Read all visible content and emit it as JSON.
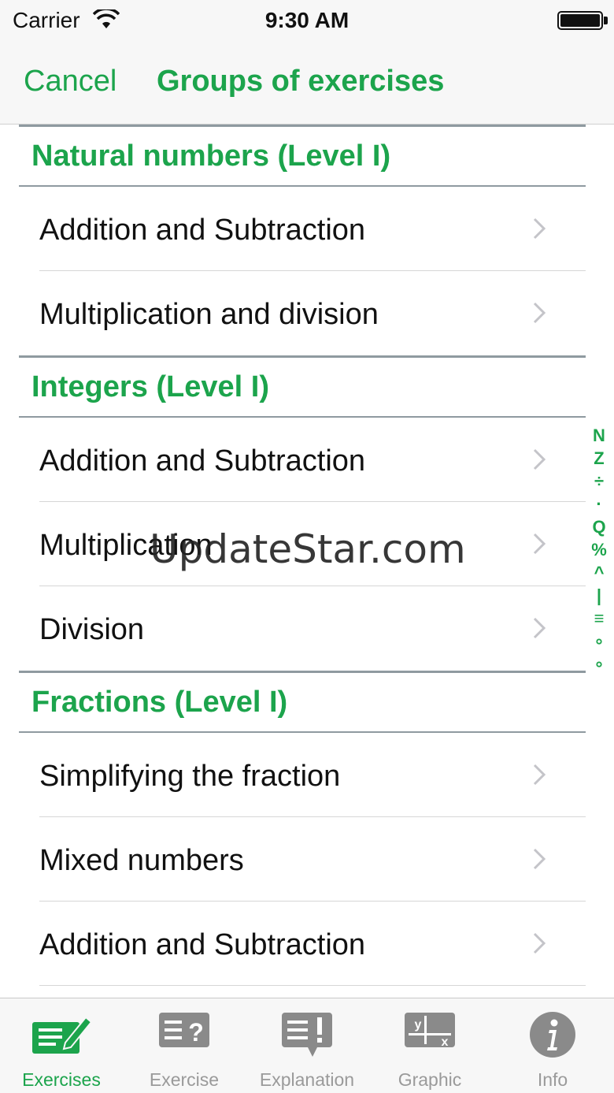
{
  "status": {
    "carrier": "Carrier",
    "time": "9:30 AM"
  },
  "nav": {
    "cancel": "Cancel",
    "title": "Groups of exercises"
  },
  "sections": [
    {
      "header": "Natural numbers (Level I)",
      "rows": [
        "Addition and Subtraction",
        "Multiplication and division"
      ]
    },
    {
      "header": "Integers (Level I)",
      "rows": [
        "Addition and Subtraction",
        "Multiplication",
        "Division"
      ]
    },
    {
      "header": "Fractions (Level I)",
      "rows": [
        "Simplifying the fraction",
        "Mixed numbers",
        "Addition and Subtraction"
      ]
    }
  ],
  "index": [
    "N",
    "Z",
    "÷",
    "·",
    "Q",
    "%",
    "^",
    "|",
    "≡",
    "∘",
    "∘",
    "-"
  ],
  "watermark": "UpdateStar.com",
  "tabs": [
    {
      "label": "Exercises",
      "icon": "pencil-note-icon",
      "active": true
    },
    {
      "label": "Exercise",
      "icon": "question-list-icon",
      "active": false
    },
    {
      "label": "Explanation",
      "icon": "exclamation-bubble-icon",
      "active": false
    },
    {
      "label": "Graphic",
      "icon": "graph-axes-icon",
      "active": false
    },
    {
      "label": "Info",
      "icon": "info-icon",
      "active": false
    }
  ],
  "colors": {
    "accent": "#1ca44c",
    "inactive": "#9a9a9a"
  }
}
